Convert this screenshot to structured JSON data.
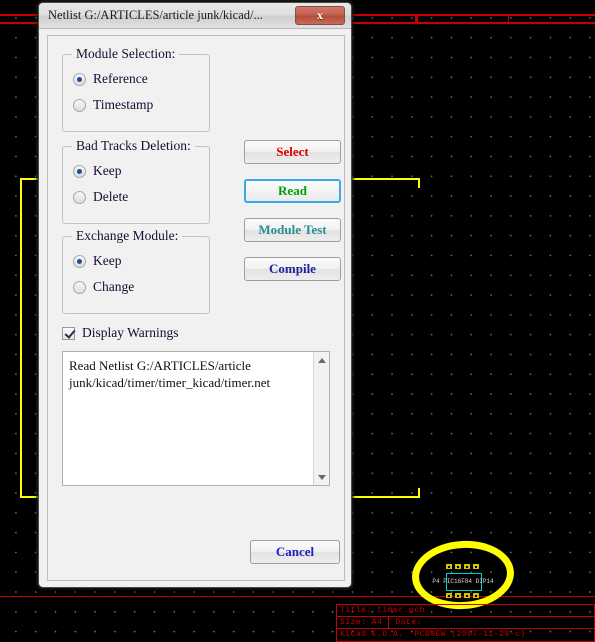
{
  "background": {
    "app": "PCBNEW",
    "title_block": {
      "title_label": "Title:",
      "title_value": "timer.pcb",
      "size_label": "Size: A4",
      "date_label": "Date:",
      "tool_label": "KiCad E.D.A.",
      "tool_value": "PCBNEW (2007-11-29-c)"
    },
    "footprint": {
      "reference": "P4 PIC16F84 DIP14"
    },
    "annotations": {
      "circle_label": "highlight-circle",
      "check_label": "highlight-check"
    },
    "colors": {
      "canvas": "#000000",
      "sheet_frame": "#c80000",
      "board_outline": "#ffff00",
      "annotation": "#ffff00",
      "pad": "#d4c200",
      "courtyard": "#00cccc"
    }
  },
  "dialog": {
    "title": "Netlist G:/ARTICLES/article junk/kicad/...",
    "close_label": "x",
    "groups": [
      {
        "id": "module-selection",
        "title": "Module Selection:",
        "options": [
          {
            "label": "Reference",
            "checked": true
          },
          {
            "label": "Timestamp",
            "checked": false
          }
        ]
      },
      {
        "id": "bad-tracks-deletion",
        "title": "Bad Tracks Deletion:",
        "options": [
          {
            "label": "Keep",
            "checked": true
          },
          {
            "label": "Delete",
            "checked": false
          }
        ]
      },
      {
        "id": "exchange-module",
        "title": "Exchange Module:",
        "options": [
          {
            "label": "Keep",
            "checked": true
          },
          {
            "label": "Change",
            "checked": false
          }
        ]
      }
    ],
    "checkbox": {
      "label": "Display Warnings",
      "checked": true
    },
    "buttons": {
      "select": "Select",
      "read": "Read",
      "module_test": "Module Test",
      "compile": "Compile",
      "cancel": "Cancel"
    },
    "button_colors": {
      "select": "#e00000",
      "read": "#00a000",
      "module_test": "#2a8e8e",
      "compile": "#20209a",
      "cancel": "#2020c0",
      "focus_ring": "#3aa9e8"
    },
    "output": {
      "text": "Read Netlist G:/ARTICLES/article junk/kicad/timer/timer_kicad/timer.net"
    }
  }
}
